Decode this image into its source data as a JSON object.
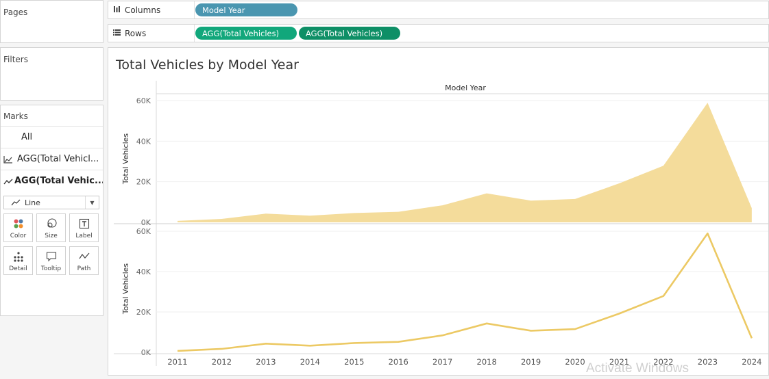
{
  "left_panel": {
    "pages_title": "Pages",
    "filters_title": "Filters",
    "marks_title": "Marks",
    "marks_all": "All",
    "marks_items": [
      "AGG(Total Vehicl...",
      "AGG(Total Vehic..."
    ],
    "mark_type": "Line",
    "mark_buttons": [
      {
        "label": "Color",
        "icon": "color-icon"
      },
      {
        "label": "Size",
        "icon": "size-icon"
      },
      {
        "label": "Label",
        "icon": "label-icon"
      },
      {
        "label": "Detail",
        "icon": "detail-icon"
      },
      {
        "label": "Tooltip",
        "icon": "tooltip-icon"
      },
      {
        "label": "Path",
        "icon": "path-icon"
      }
    ]
  },
  "shelves": {
    "columns_label": "Columns",
    "columns_pills": [
      "Model Year"
    ],
    "rows_label": "Rows",
    "rows_pills": [
      "AGG(Total Vehicles)",
      "AGG(Total Vehicles)"
    ]
  },
  "colors": {
    "area_fill": "#f4dc9b",
    "line": "#ecc964",
    "pill_dimension": "#4a96b0",
    "pill_measure": "#11a77b",
    "pill_measure_dark": "#0e8f66"
  },
  "view": {
    "title": "Total Vehicles by Model Year",
    "header": "Model Year"
  },
  "chart_data": [
    {
      "type": "area",
      "title": "Total Vehicles by Model Year",
      "xlabel": "Model Year",
      "ylabel": "Total Vehicles",
      "categories": [
        "2011",
        "2012",
        "2013",
        "2014",
        "2015",
        "2016",
        "2017",
        "2018",
        "2019",
        "2020",
        "2021",
        "2022",
        "2023",
        "2024"
      ],
      "series": [
        {
          "values": [
            700,
            1700,
            4300,
            3300,
            4600,
            5200,
            8400,
            14300,
            10700,
            11500,
            19200,
            27900,
            58900,
            7000
          ]
        }
      ],
      "yticks": [
        "0K",
        "20K",
        "40K",
        "60K"
      ],
      "ylim": [
        0,
        60000
      ],
      "grid": true
    },
    {
      "type": "line",
      "title": "Total Vehicles by Model Year",
      "xlabel": "Model Year",
      "ylabel": "Total Vehicles",
      "categories": [
        "2011",
        "2012",
        "2013",
        "2014",
        "2015",
        "2016",
        "2017",
        "2018",
        "2019",
        "2020",
        "2021",
        "2022",
        "2023",
        "2024"
      ],
      "series": [
        {
          "values": [
            700,
            1700,
            4300,
            3300,
            4600,
            5200,
            8400,
            14300,
            10700,
            11500,
            19200,
            27900,
            58900,
            7000
          ]
        }
      ],
      "yticks": [
        "0K",
        "20K",
        "40K",
        "60K"
      ],
      "ylim": [
        0,
        60000
      ],
      "grid": true
    }
  ],
  "watermark": "Activate Windows"
}
